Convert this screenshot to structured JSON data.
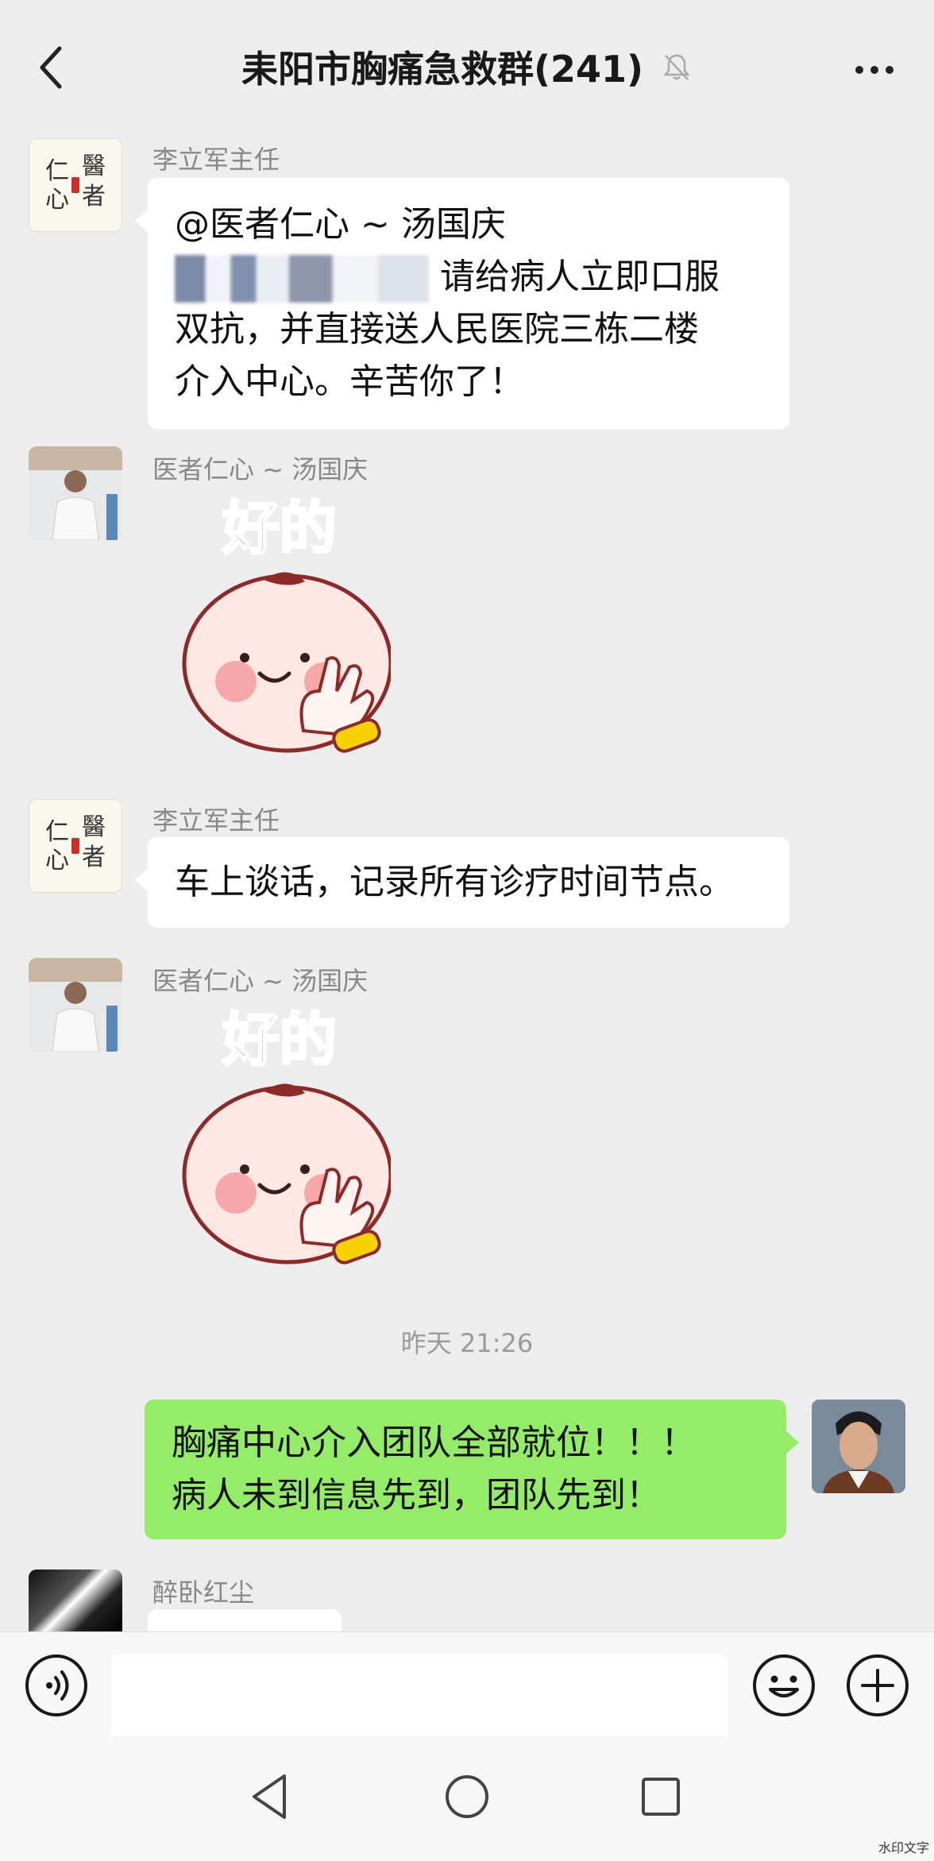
{
  "header": {
    "title": "耒阳市胸痛急救群(241)"
  },
  "messages": [
    {
      "sender": "李立军主任",
      "avatar_text": [
        "仁",
        "心",
        "醫",
        "者"
      ],
      "lines": [
        "@医者仁心 ~ 汤国庆",
        "请给病人立即口服",
        "双抗，并直接送人民医院三栋二楼",
        "介入中心。辛苦你了！"
      ]
    },
    {
      "sender": "医者仁心 ~ 汤国庆",
      "sticker_text": "好的"
    },
    {
      "sender": "李立军主任",
      "avatar_text": [
        "仁",
        "心",
        "醫",
        "者"
      ],
      "lines": [
        "车上谈话，记录所有诊疗时间节点。"
      ]
    },
    {
      "sender": "医者仁心 ~ 汤国庆",
      "sticker_text": "好的"
    }
  ],
  "timestamp": "昨天 21:26",
  "own_message": {
    "lines": [
      "胸痛中心介入团队全部就位！！！",
      "病人未到信息先到，团队先到！"
    ]
  },
  "last_message": {
    "sender": "醉卧红尘"
  },
  "watermark": "水印文字",
  "colors": {
    "background": "#ededed",
    "own_bubble": "#95ec69",
    "other_bubble": "#ffffff"
  }
}
